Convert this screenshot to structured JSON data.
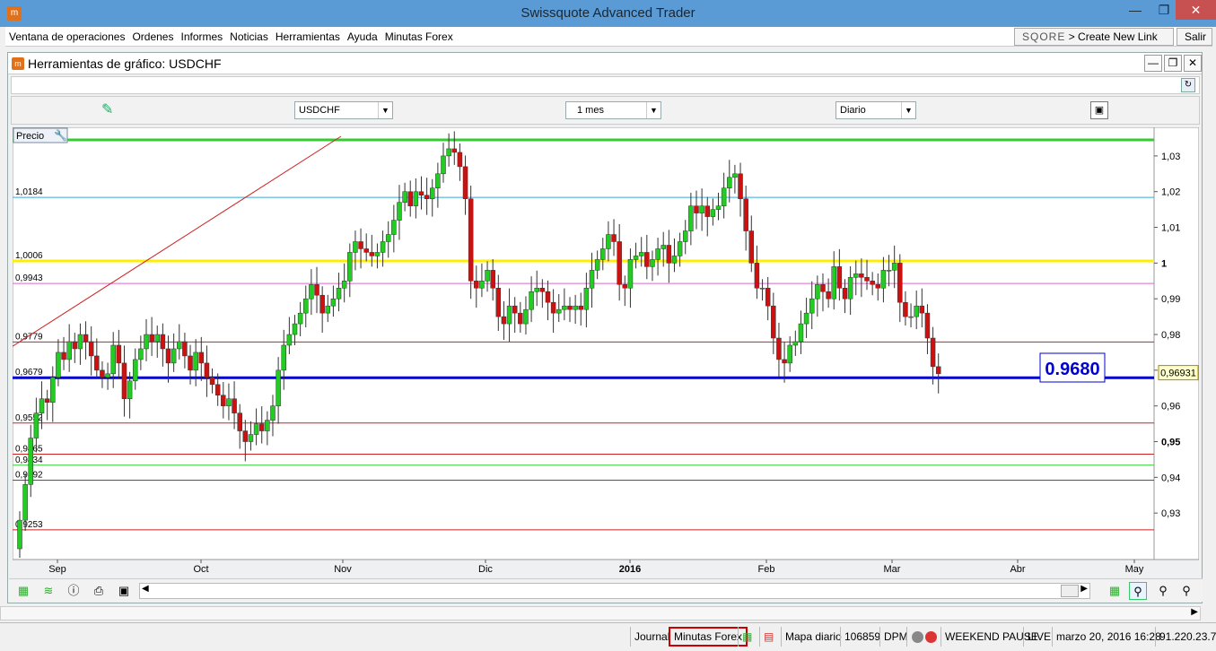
{
  "window": {
    "title": "Swissquote Advanced Trader",
    "app_icon_text": "m"
  },
  "menu": {
    "items": [
      "Ventana de operaciones",
      "Ordenes",
      "Informes",
      "Noticias",
      "Herramientas",
      "Ayuda",
      "Minutas Forex"
    ],
    "score_logo": "SQORE",
    "create_link": "> Create New Link",
    "exit": "Salir"
  },
  "chart_window": {
    "title": "Herramientas de gráfico: USDCHF",
    "symbol": "USDCHF",
    "period": "1 mes",
    "interval": "Diario",
    "price_tab": "Precio"
  },
  "chart_data": {
    "type": "candlestick",
    "symbol": "USDCHF",
    "ylim": [
      0.9205,
      1.0355
    ],
    "y_ticks": [
      0.93,
      0.94,
      0.95,
      0.96,
      0.97,
      0.98,
      0.99,
      1.0,
      1.01,
      1.02,
      1.03
    ],
    "y_tick_labels": [
      "0,93",
      "0,94",
      "0,95",
      "0,96",
      "0,97",
      "0,98",
      "0,99",
      "1",
      "1,01",
      "1,02",
      "1,03"
    ],
    "x_labels": [
      "Sep",
      "Oct",
      "Nov",
      "Dic",
      "2016",
      "Feb",
      "Mar",
      "Abr",
      "May"
    ],
    "current_price_label": "0,96931",
    "current_price": 0.96931,
    "annotation": "0.9680",
    "horizontal_lines": [
      {
        "value": 1.0345,
        "color": "#33cc33",
        "label": ""
      },
      {
        "value": 1.0184,
        "color": "#33aadd",
        "label": "1,0184"
      },
      {
        "value": 1.0006,
        "color": "#ffee00",
        "label": "1,0006"
      },
      {
        "value": 0.9943,
        "color": "#dd66cc",
        "label": "0,9943"
      },
      {
        "value": 0.9779,
        "color": "#cc2222",
        "label": "0,9779"
      },
      {
        "value": 0.9679,
        "color": "#0000cc",
        "label": "0,9679"
      },
      {
        "value": 0.9552,
        "color": "#cc2222",
        "label": "0,9552"
      },
      {
        "value": 0.9465,
        "color": "#cc2222",
        "label": "0,9465"
      },
      {
        "value": 0.9434,
        "color": "#33cc33",
        "label": "0,9434"
      },
      {
        "value": 0.9392,
        "color": "#cc2222",
        "label": "0,9392"
      },
      {
        "value": 0.9253,
        "color": "#cc2222",
        "label": "0,9253"
      }
    ],
    "closes": [
      0.928,
      0.938,
      0.951,
      0.958,
      0.962,
      0.961,
      0.968,
      0.975,
      0.973,
      0.978,
      0.976,
      0.98,
      0.978,
      0.974,
      0.97,
      0.968,
      0.969,
      0.977,
      0.972,
      0.962,
      0.967,
      0.973,
      0.976,
      0.98,
      0.978,
      0.98,
      0.976,
      0.972,
      0.976,
      0.978,
      0.974,
      0.97,
      0.975,
      0.972,
      0.968,
      0.966,
      0.963,
      0.96,
      0.962,
      0.958,
      0.953,
      0.95,
      0.952,
      0.955,
      0.953,
      0.956,
      0.96,
      0.97,
      0.977,
      0.98,
      0.983,
      0.986,
      0.99,
      0.994,
      0.991,
      0.986,
      0.988,
      0.99,
      0.993,
      0.995,
      1.003,
      1.006,
      1.004,
      1.003,
      1.002,
      1.003,
      1.006,
      1.008,
      1.012,
      1.017,
      1.02,
      1.016,
      1.02,
      1.019,
      1.018,
      1.021,
      1.025,
      1.03,
      1.032,
      1.031,
      1.027,
      1.018,
      0.995,
      0.993,
      0.995,
      0.998,
      0.993,
      0.985,
      0.983,
      0.988,
      0.986,
      0.983,
      0.987,
      0.992,
      0.993,
      0.992,
      0.989,
      0.986,
      0.987,
      0.988,
      0.987,
      0.988,
      0.987,
      0.993,
      0.998,
      1.001,
      1.004,
      1.008,
      1.006,
      0.994,
      0.993,
      1.001,
      1.002,
      1.003,
      0.999,
      1.001,
      1.004,
      1.005,
      1.0,
      1.002,
      1.006,
      1.009,
      1.016,
      1.014,
      1.016,
      1.013,
      1.015,
      1.016,
      1.021,
      1.024,
      1.025,
      1.018,
      1.009,
      1.0,
      0.993,
      0.993,
      0.988,
      0.979,
      0.973,
      0.972,
      0.977,
      0.978,
      0.983,
      0.986,
      0.99,
      0.994,
      0.992,
      0.99,
      0.999,
      0.993,
      0.99,
      0.996,
      0.997,
      0.996,
      0.995,
      0.994,
      0.993,
      0.998,
      0.998,
      1.0,
      0.989,
      0.985,
      0.985,
      0.988,
      0.986,
      0.979,
      0.971,
      0.969
    ]
  },
  "bottom_toolbar": {
    "icons": [
      "chart-icon",
      "indicator-icon",
      "info-icon",
      "print-icon",
      "save-icon"
    ]
  },
  "status": {
    "journal": "Journal",
    "minutas": "Minutas Forex",
    "mapa": "Mapa diario",
    "code": "106859",
    "dpm": "DPM",
    "weekend": "WEEKEND PAUSE",
    "live": "LIVE",
    "datetime": "marzo 20, 2016 16:28",
    "ip": "91.220.23.7"
  },
  "colors": {
    "up": "#22cc22",
    "down": "#cc1111",
    "wick": "#333333",
    "trend": "#cc2222"
  }
}
